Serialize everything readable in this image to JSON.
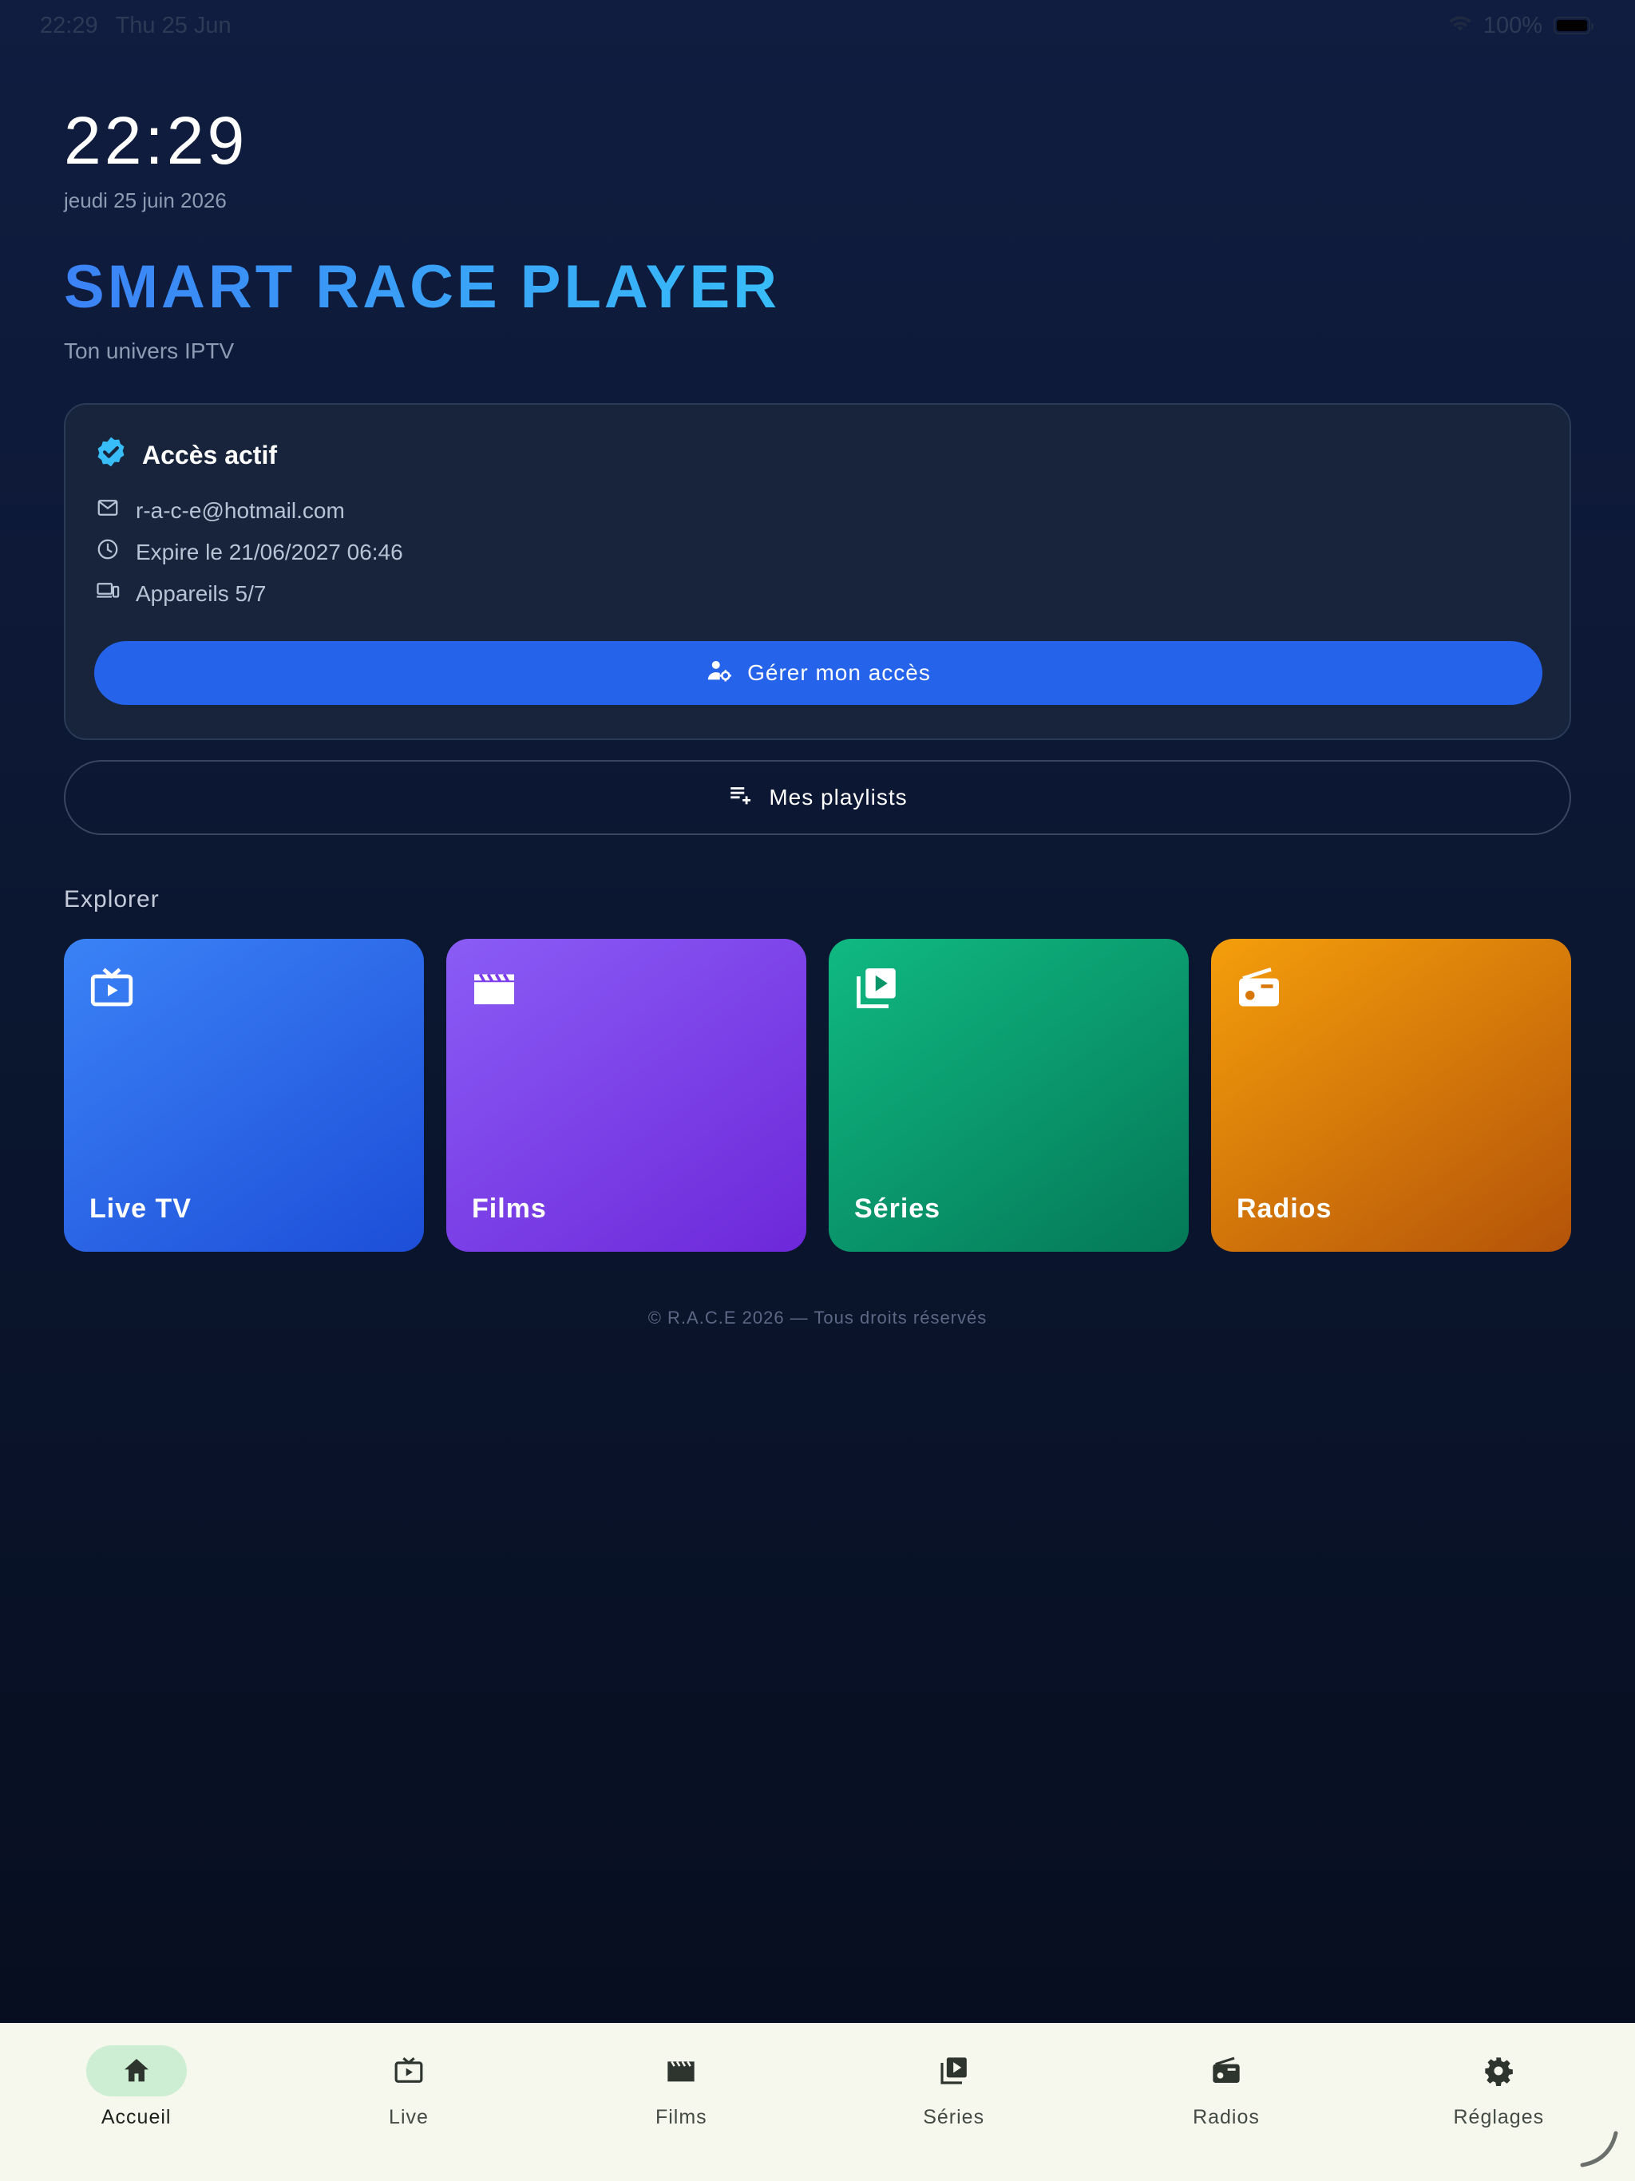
{
  "status_bar": {
    "time": "22:29",
    "date": "Thu 25 Jun",
    "battery": "100%"
  },
  "header": {
    "clock": "22:29",
    "date": "jeudi 25 juin 2026",
    "brand": "SMART RACE PLAYER",
    "tagline": "Ton univers IPTV"
  },
  "access": {
    "title": "Accès actif",
    "email": "r-a-c-e@hotmail.com",
    "expiry": "Expire le 21/06/2027 06:46",
    "devices": "Appareils 5/7",
    "manage_label": "Gérer mon accès"
  },
  "playlists_label": "Mes playlists",
  "explore": {
    "title": "Explorer",
    "tiles": [
      {
        "label": "Live TV",
        "icon": "live-tv-icon"
      },
      {
        "label": "Films",
        "icon": "movie-icon"
      },
      {
        "label": "Séries",
        "icon": "series-icon"
      },
      {
        "label": "Radios",
        "icon": "radio-icon"
      }
    ]
  },
  "footer": "© R.A.C.E 2026 — Tous droits réservés",
  "nav": [
    {
      "label": "Accueil",
      "icon": "home-icon",
      "active": true
    },
    {
      "label": "Live",
      "icon": "live-tv-icon"
    },
    {
      "label": "Films",
      "icon": "movie-icon"
    },
    {
      "label": "Séries",
      "icon": "series-icon"
    },
    {
      "label": "Radios",
      "icon": "radio-icon"
    },
    {
      "label": "Réglages",
      "icon": "gear-icon"
    }
  ],
  "colors": {
    "accent": "#2563eb",
    "brand_gradient": [
      "#3b82f6",
      "#38bdf8"
    ],
    "verified": "#38bdf8",
    "live": "#3b82f6",
    "films": "#8b5cf6",
    "series": "#10b981",
    "radios": "#f59e0b",
    "nav_bg": "#f6f8ee",
    "nav_active": "#cdeed2"
  }
}
